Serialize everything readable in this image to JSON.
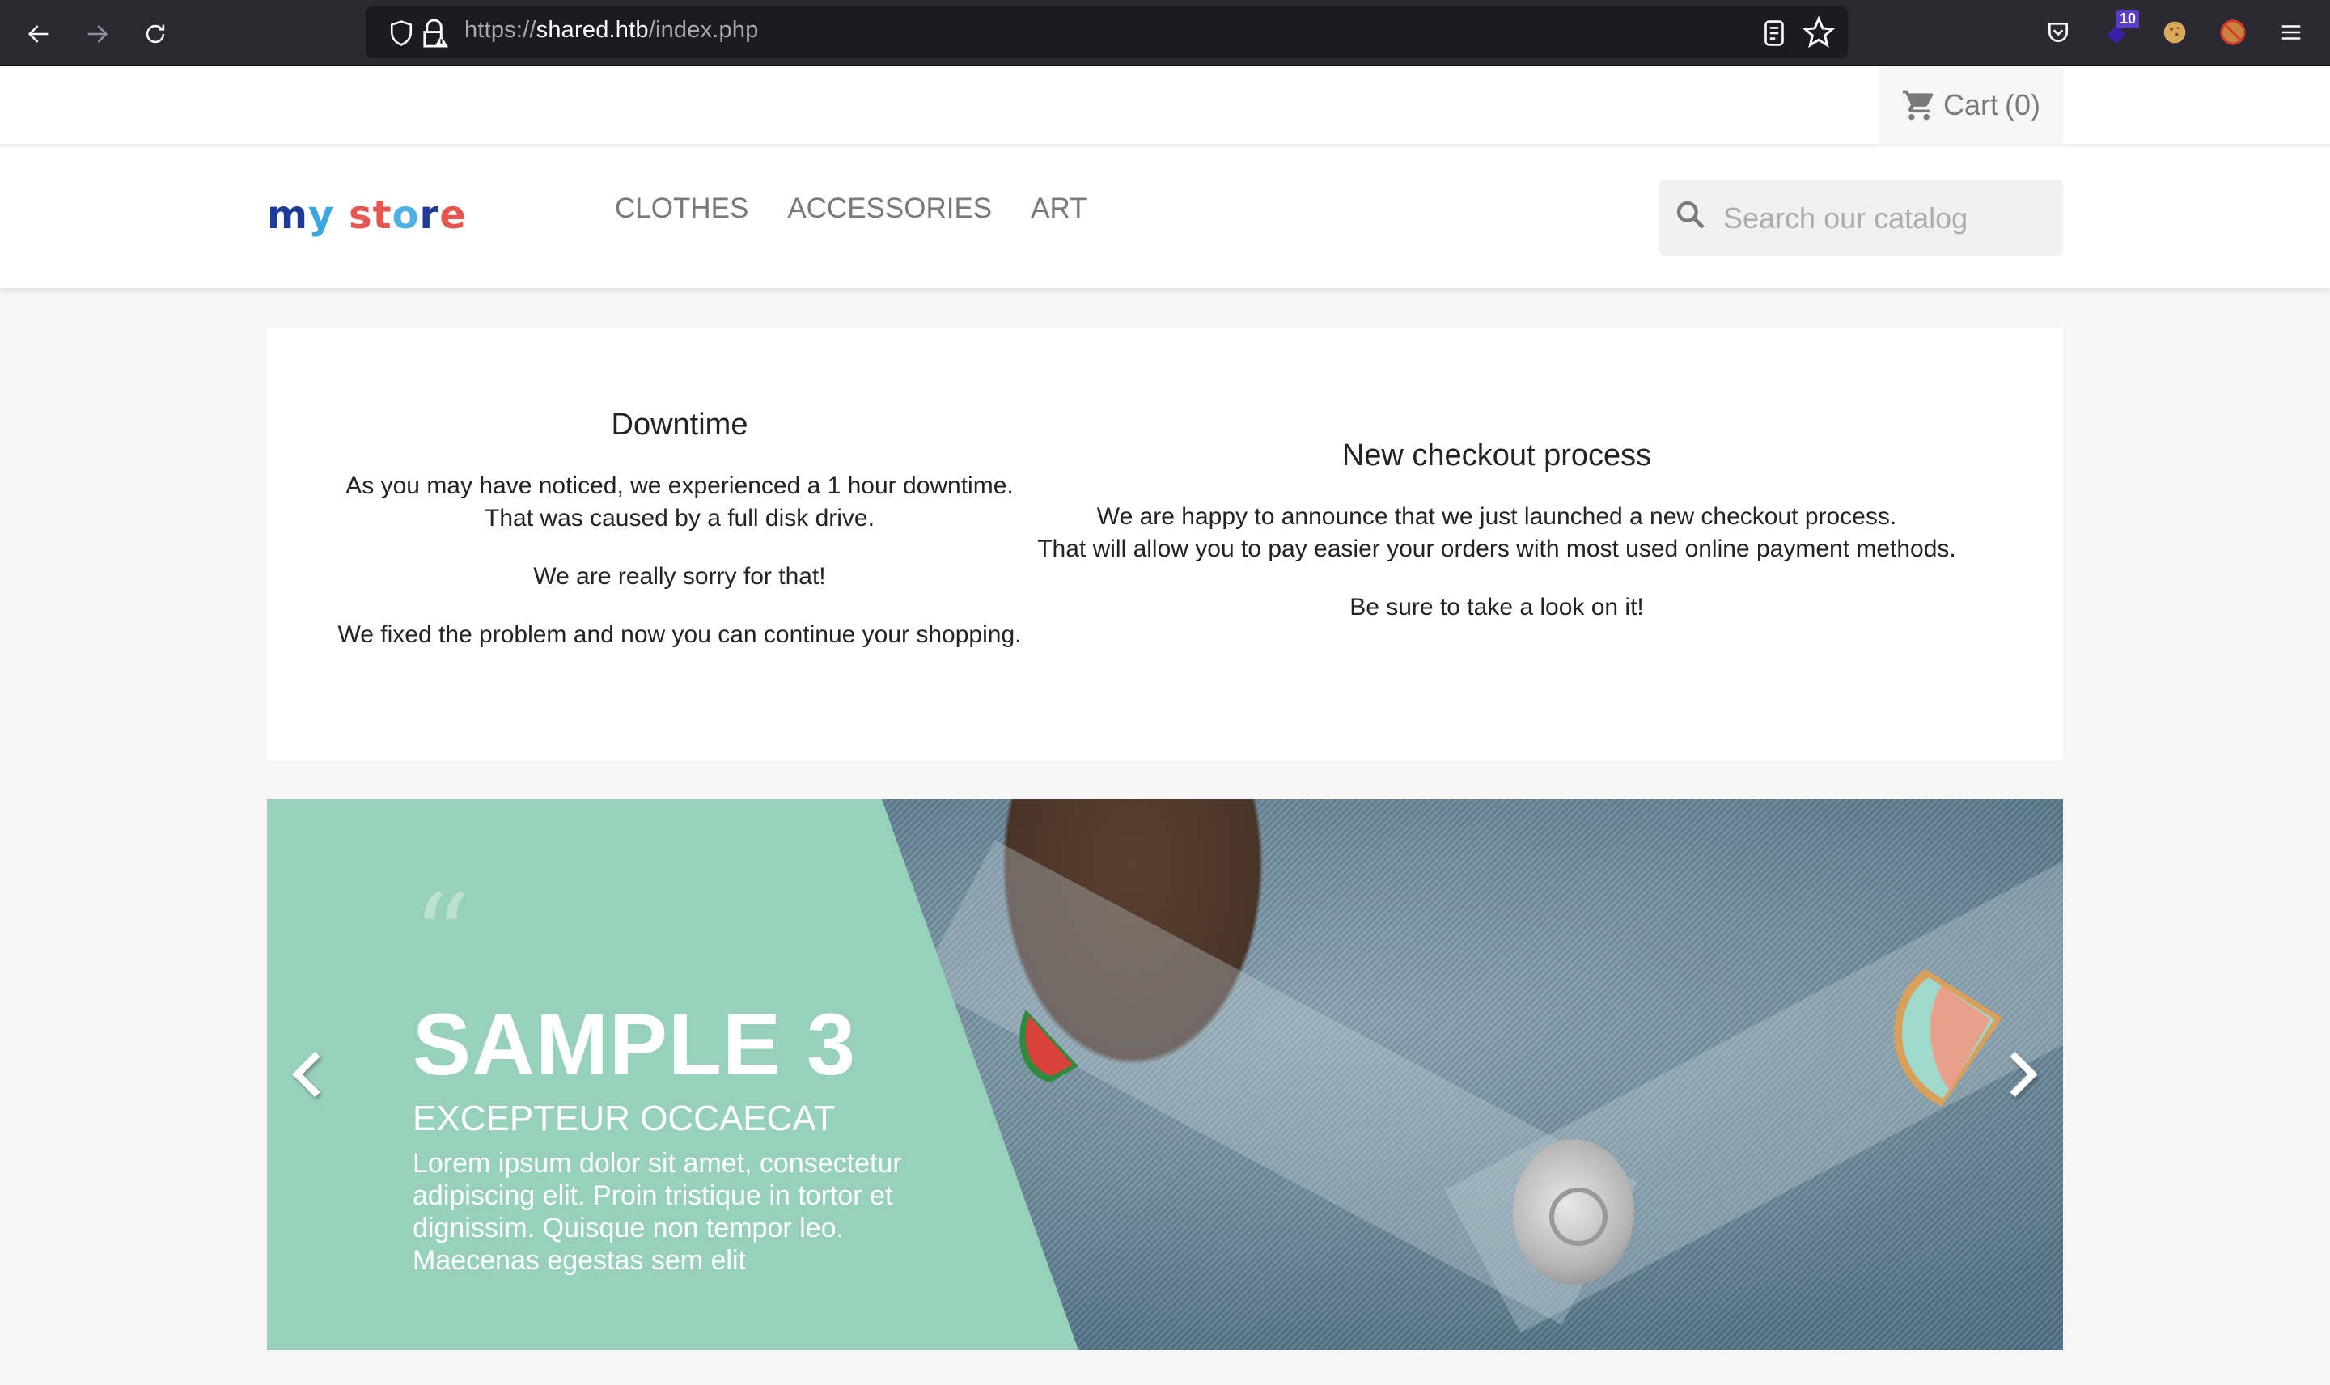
{
  "browser": {
    "url_scheme": "https://",
    "url_host": "shared.htb",
    "url_path": "/index.php",
    "extension_badge": "10"
  },
  "topnav": {
    "cart_label": "Cart",
    "cart_count": "(0)"
  },
  "header": {
    "logo": [
      "m",
      "y",
      " ",
      "s",
      "t",
      "o",
      "r",
      "e"
    ],
    "menu": [
      {
        "label": "CLOTHES"
      },
      {
        "label": "ACCESSORIES"
      },
      {
        "label": "ART"
      }
    ],
    "search_placeholder": "Search our catalog"
  },
  "notices": [
    {
      "title": "Downtime",
      "paragraphs": [
        "As you may have noticed, we experienced a 1 hour downtime.",
        "That was caused by a full disk drive.",
        "We are really sorry for that!",
        "We fixed the problem and now you can continue your shopping."
      ]
    },
    {
      "title": "New checkout process",
      "paragraphs": [
        "We are happy to announce that we just launched a new checkout process.",
        "That will allow you to pay easier your orders with most used online payment methods.",
        "Be sure to take a look on it!"
      ]
    }
  ],
  "slider": {
    "quote_mark": "“",
    "title": "SAMPLE 3",
    "subtitle": "EXCEPTEUR OCCAECAT",
    "description": "Lorem ipsum dolor sit amet, consectetur adipiscing elit. Proin tristique in tortor et dignissim. Quisque non tempor leo. Maecenas egestas sem elit",
    "accent_color": "#97d1bb"
  }
}
